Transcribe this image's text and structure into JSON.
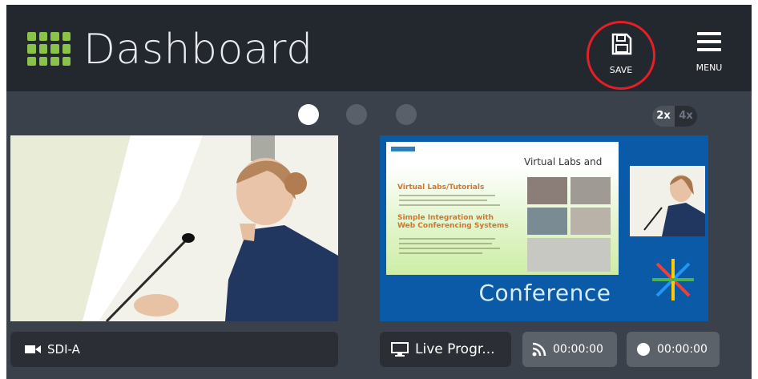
{
  "header": {
    "title": "Dashboard",
    "save_label": "SAVE",
    "menu_label": "MENU"
  },
  "pager": {
    "active_index": 0,
    "count": 3
  },
  "zoom": {
    "options": [
      "2x",
      "4x"
    ],
    "selected": "2x"
  },
  "panels": {
    "left": {
      "source_label": "SDI-A"
    },
    "right": {
      "slide_title": "Virtual Labs and Tutorials",
      "slide_heading_1": "Virtual Labs/Tutorials",
      "slide_heading_2": "Simple Integration with Web Conferencing Systems",
      "overlay_text": "Conference",
      "source_label": "Live Progr..."
    }
  },
  "status": {
    "stream_time": "00:00:00",
    "record_time": "00:00:00"
  },
  "colors": {
    "header_bg": "#23272e",
    "accent_green": "#8bc34a",
    "highlight_red": "#e41f26"
  }
}
